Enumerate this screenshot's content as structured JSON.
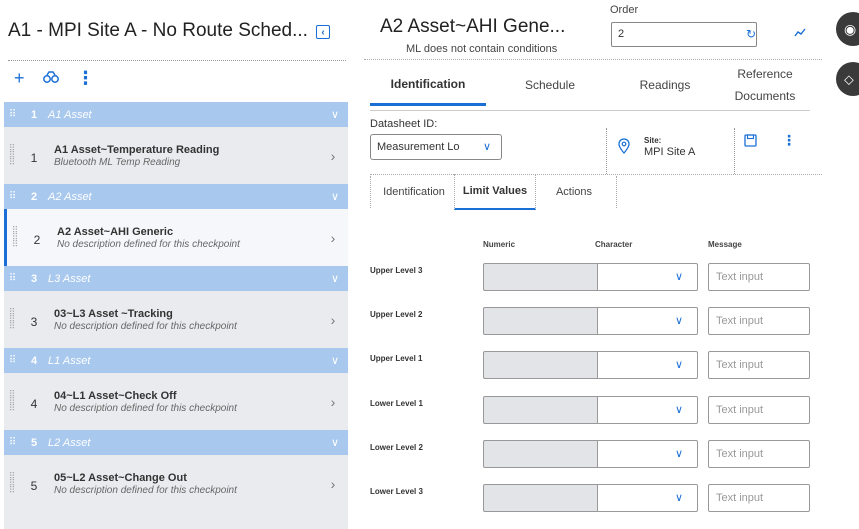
{
  "left": {
    "title": "A1 - MPI Site A - No Route Sched...",
    "collapse_icon": "chevron-left-icon",
    "toolbar": {
      "add": "+",
      "binoculars": "ඹ",
      "more": "⋮"
    },
    "groups": [
      {
        "num": "1",
        "name": "A1 Asset",
        "item": {
          "num": "1",
          "title": "A1 Asset~Temperature Reading",
          "desc": "Bluetooth ML Temp Reading",
          "selected": false
        }
      },
      {
        "num": "2",
        "name": "A2 Asset",
        "item": {
          "num": "2",
          "title": "A2 Asset~AHI Generic",
          "desc": "No description defined for this checkpoint",
          "selected": true
        }
      },
      {
        "num": "3",
        "name": "L3 Asset",
        "item": {
          "num": "3",
          "title": "03~L3 Asset ~Tracking",
          "desc": "No description defined for this checkpoint",
          "selected": false
        }
      },
      {
        "num": "4",
        "name": "L1 Asset",
        "item": {
          "num": "4",
          "title": "04~L1 Asset~Check Off",
          "desc": "No description defined for this checkpoint",
          "selected": false
        }
      },
      {
        "num": "5",
        "name": "L2 Asset",
        "item": {
          "num": "5",
          "title": "05~L2 Asset~Change Out",
          "desc": "No description defined for this checkpoint",
          "selected": false
        }
      }
    ]
  },
  "right": {
    "title": "A2 Asset~AHI Gene...",
    "subtitle": "ML does not contain conditions",
    "order_label": "Order",
    "order_value": "2",
    "tabs": [
      "Identification",
      "Schedule",
      "Readings",
      "Reference",
      "Documents"
    ],
    "datasheet_label": "Datasheet ID:",
    "datasheet_value": "Measurement Lo",
    "site_label": "Site:",
    "site_value": "MPI Site A",
    "subtabs": [
      "Identification",
      "Limit Values",
      "Actions"
    ],
    "columns": [
      "Numeric",
      "Character",
      "Message"
    ],
    "rows": [
      "Upper Level 3",
      "Upper Level 2",
      "Upper Level 1",
      "Lower Level 1",
      "Lower Level 2",
      "Lower Level 3"
    ],
    "message_placeholder": "Text input"
  },
  "accent_color": "#1a6fd6",
  "group_color": "#a8c8ee"
}
